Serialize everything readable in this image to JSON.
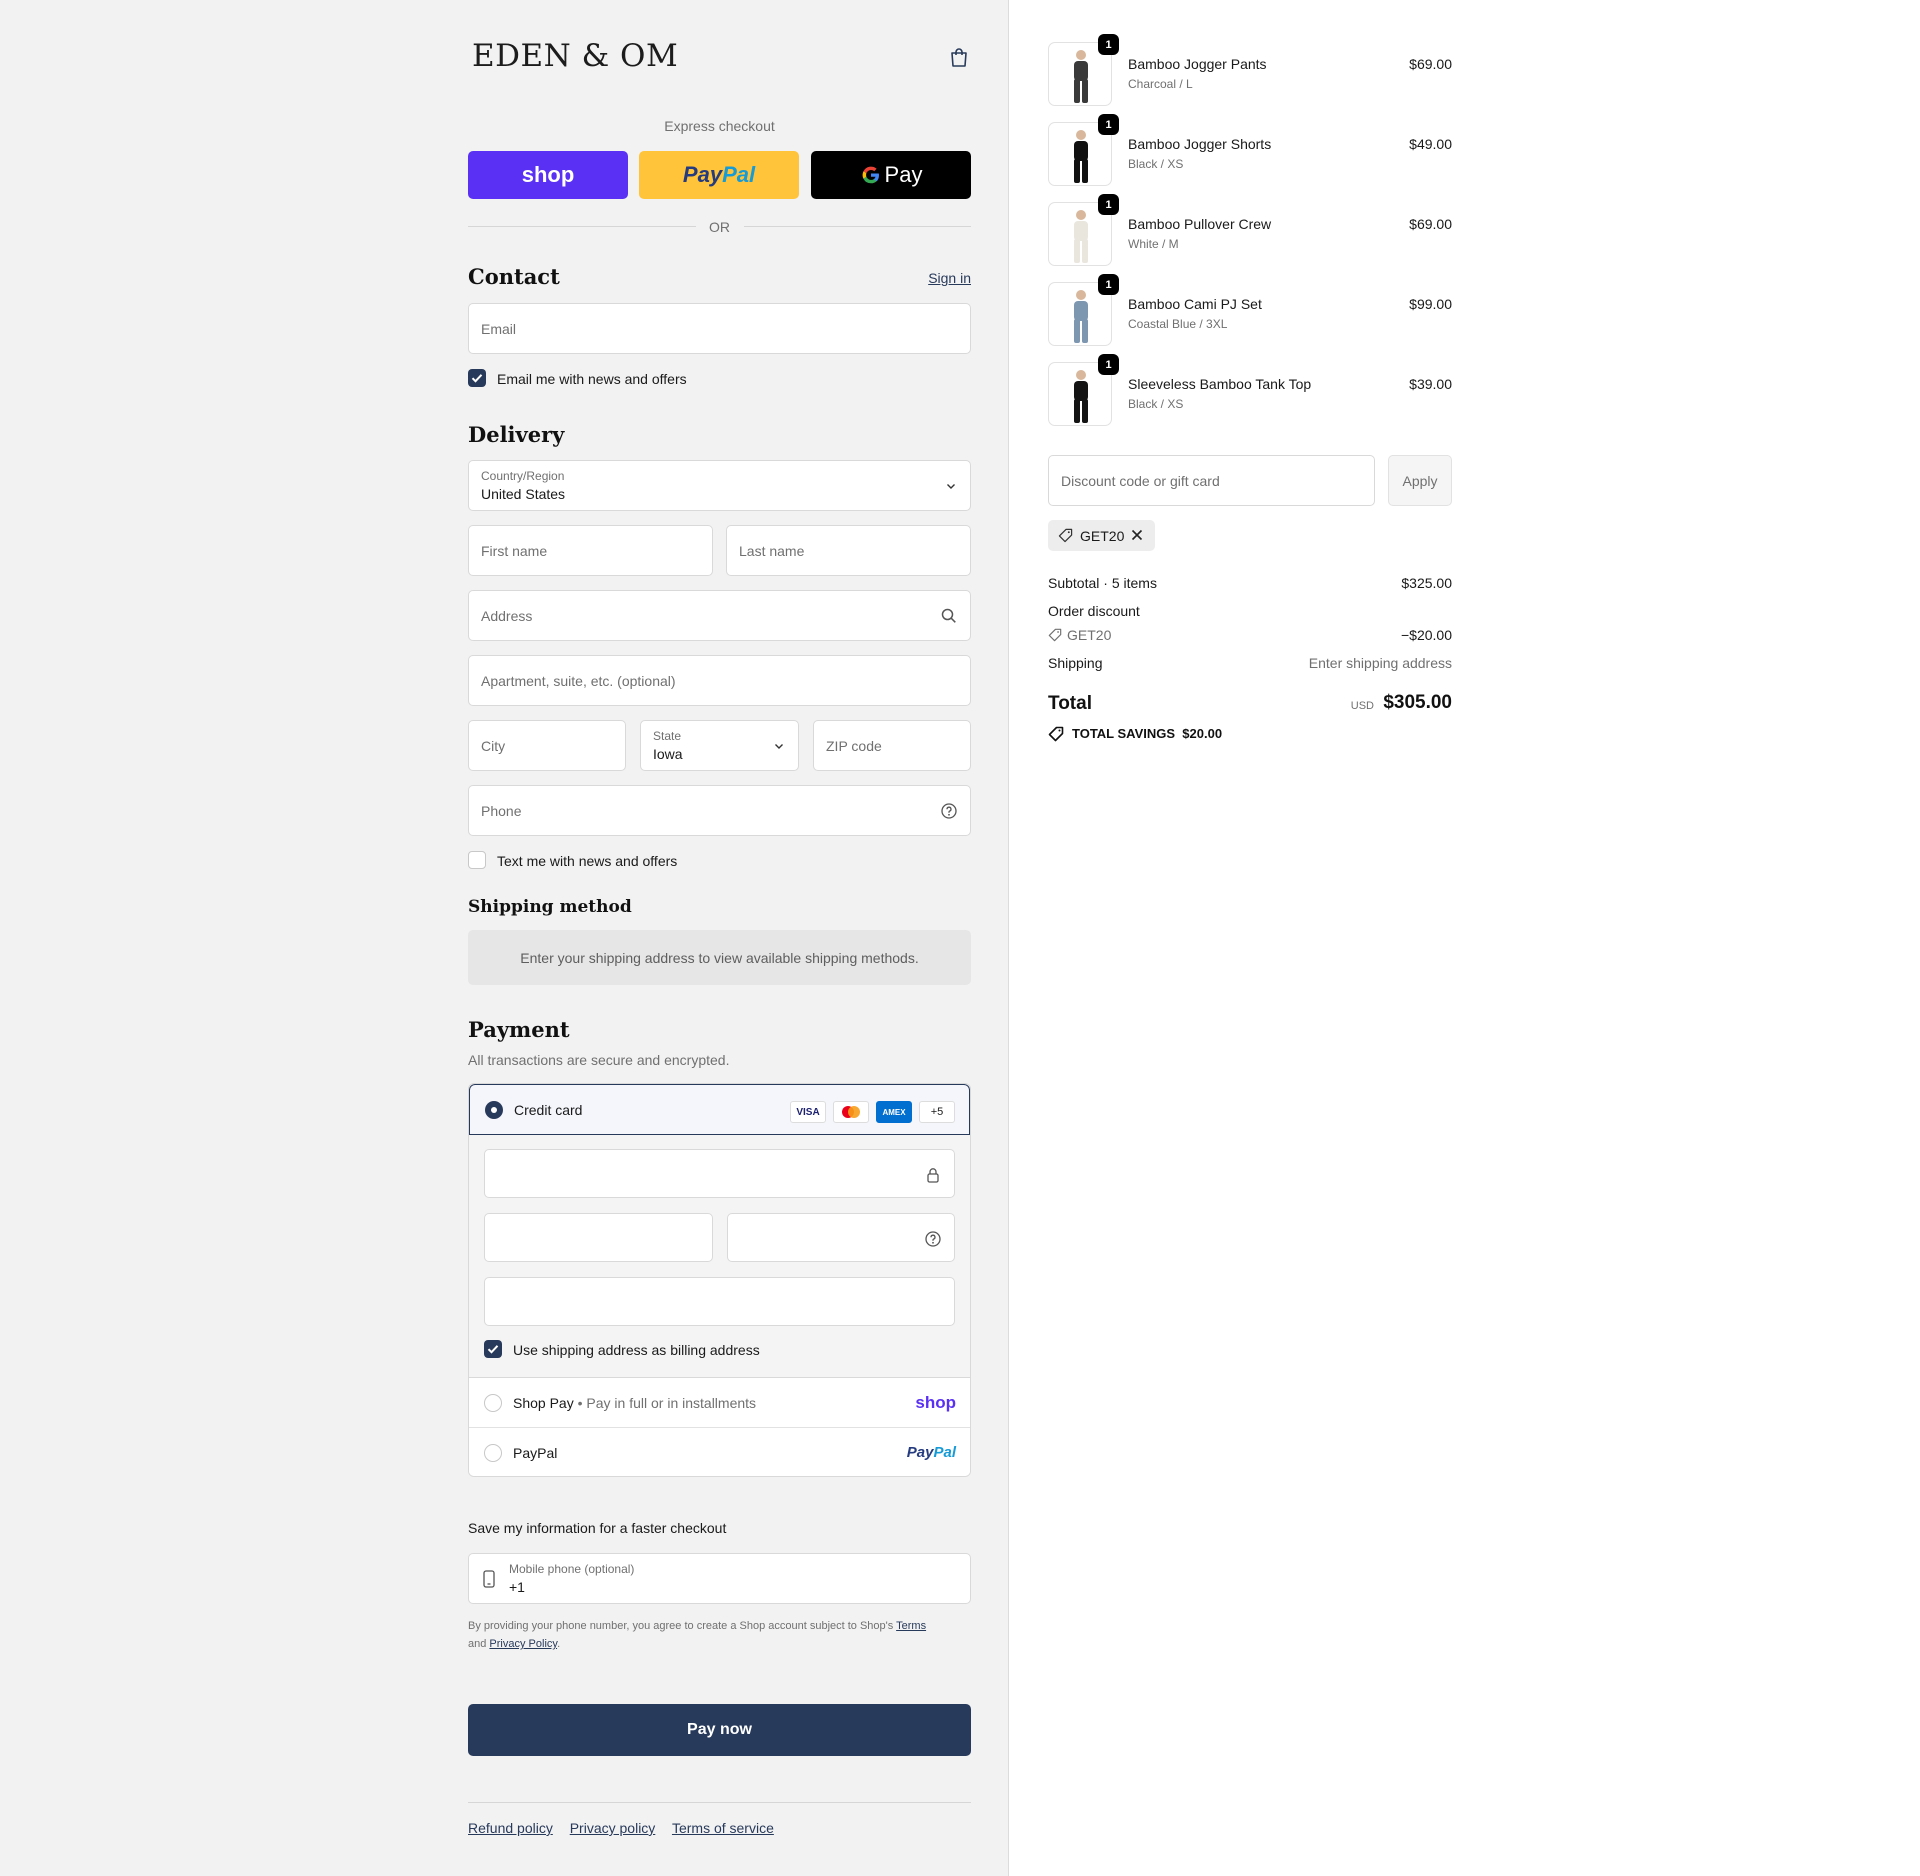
{
  "brand": {
    "logo_text": "EDEN & OM"
  },
  "express": {
    "label": "Express checkout",
    "shop_label": "shop",
    "paypal_pay": "Pay",
    "paypal_pal": "Pal",
    "gpay_label": "Pay",
    "or_label": "OR"
  },
  "contact": {
    "heading": "Contact",
    "sign_in": "Sign in",
    "email_placeholder": "Email",
    "email_optin": "Email me with news and offers"
  },
  "delivery": {
    "heading": "Delivery",
    "country_label": "Country/Region",
    "country_value": "United States",
    "first_name": "First name",
    "last_name": "Last name",
    "address": "Address",
    "apartment": "Apartment, suite, etc. (optional)",
    "city": "City",
    "state_label": "State",
    "state_value": "Iowa",
    "zip": "ZIP code",
    "phone": "Phone",
    "text_optin": "Text me with news and offers"
  },
  "shipping_method": {
    "heading": "Shipping method",
    "notice": "Enter your shipping address to view available shipping methods."
  },
  "payment": {
    "heading": "Payment",
    "secure_note": "All transactions are secure and encrypted.",
    "credit_card_label": "Credit card",
    "card_brands": [
      "VISA",
      "AMEX",
      "+5"
    ],
    "billing_same": "Use shipping address as billing address",
    "shop_pay_label": "Shop Pay",
    "shop_pay_sub": "Pay in full or in installments",
    "shop_mark": "shop",
    "paypal_label": "PayPal",
    "paypal_mark_pay": "Pay",
    "paypal_mark_pal": "Pal"
  },
  "save_info": {
    "heading": "Save my information for a faster checkout",
    "mobile_label": "Mobile phone (optional)",
    "mobile_value": "+1",
    "legal_prefix": "By providing your phone number, you agree to create a Shop account subject to Shop's",
    "terms": "Terms",
    "and": "and",
    "privacy": "Privacy Policy",
    "period": "."
  },
  "pay_now": "Pay now",
  "footer": {
    "refund": "Refund policy",
    "privacy": "Privacy policy",
    "terms": "Terms of service"
  },
  "items": [
    {
      "name": "Bamboo Jogger Pants",
      "variant": "Charcoal / L",
      "price": "$69.00",
      "qty": "1",
      "color": "#3a3a3a"
    },
    {
      "name": "Bamboo Jogger Shorts",
      "variant": "Black / XS",
      "price": "$49.00",
      "qty": "1",
      "color": "#111111"
    },
    {
      "name": "Bamboo Pullover Crew",
      "variant": "White / M",
      "price": "$69.00",
      "qty": "1",
      "color": "#e9e6de"
    },
    {
      "name": "Bamboo Cami PJ Set",
      "variant": "Coastal Blue / 3XL",
      "price": "$99.00",
      "qty": "1",
      "color": "#7d97b1"
    },
    {
      "name": "Sleeveless Bamboo Tank Top",
      "variant": "Black / XS",
      "price": "$39.00",
      "qty": "1",
      "color": "#141414"
    }
  ],
  "discount": {
    "placeholder": "Discount code or gift card",
    "apply": "Apply",
    "code": "GET20"
  },
  "summary": {
    "subtotal_label": "Subtotal · 5 items",
    "subtotal_value": "$325.00",
    "order_discount_label": "Order discount",
    "discount_code": "GET20",
    "discount_value": "−$20.00",
    "shipping_label": "Shipping",
    "shipping_value": "Enter shipping address",
    "total_label": "Total",
    "currency": "USD",
    "total_value": "$305.00",
    "savings_label": "TOTAL SAVINGS",
    "savings_value": "$20.00"
  },
  "colors": {
    "accent": "#283a5b",
    "shop_purple": "#5a31f4",
    "paypal_yellow": "#ffc439"
  }
}
